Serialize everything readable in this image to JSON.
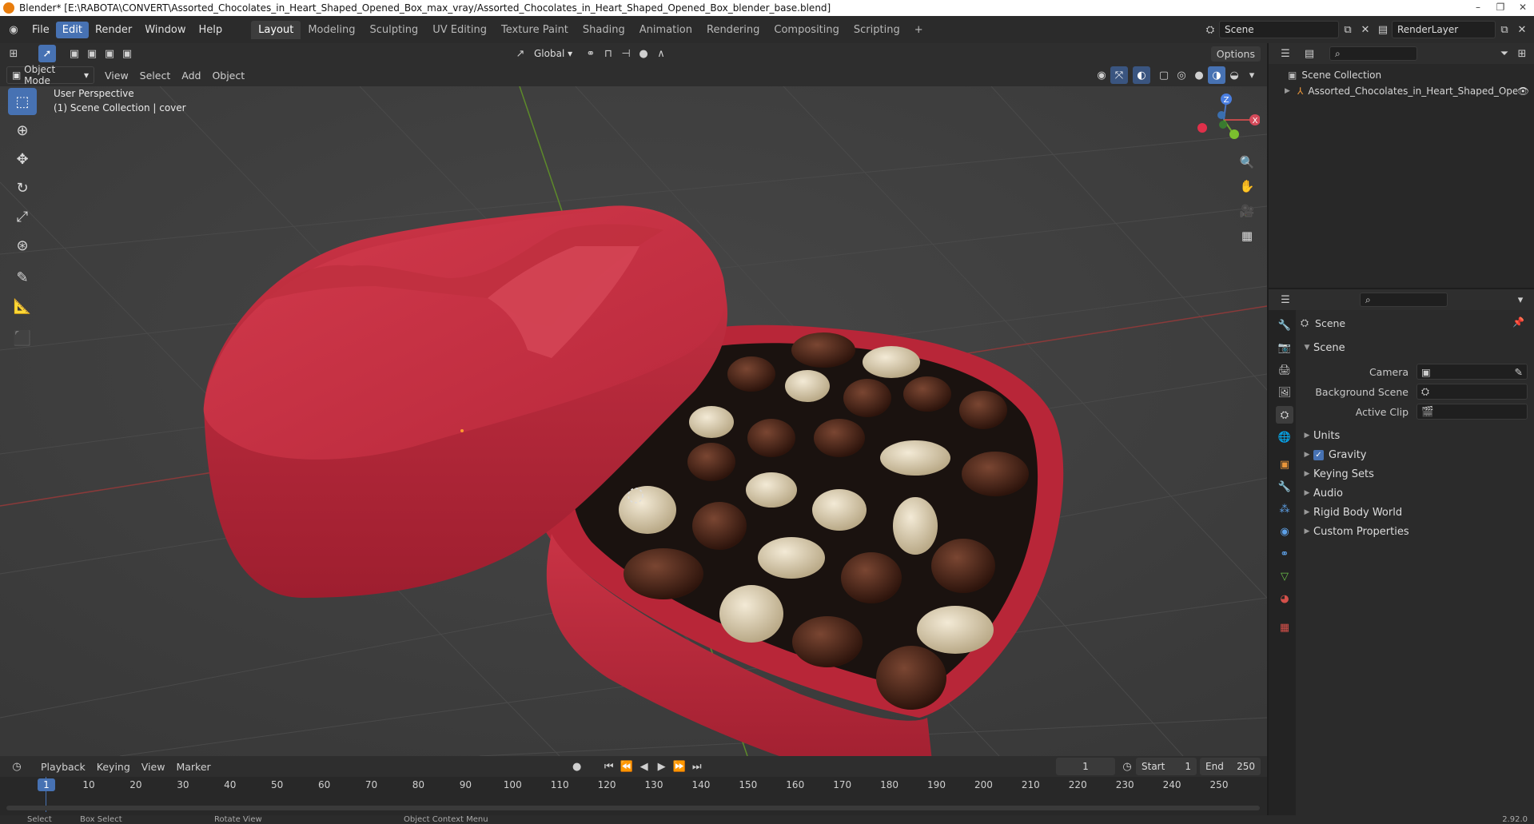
{
  "window": {
    "title": "Blender* [E:\\RABOTA\\CONVERT\\Assorted_Chocolates_in_Heart_Shaped_Opened_Box_max_vray/Assorted_Chocolates_in_Heart_Shaped_Opened_Box_blender_base.blend]",
    "controls": [
      "–",
      "❐",
      "✕"
    ]
  },
  "menu": {
    "items": [
      "File",
      "Edit",
      "Render",
      "Window",
      "Help"
    ],
    "active": "Edit"
  },
  "workspaces": {
    "tabs": [
      "Layout",
      "Modeling",
      "Sculpting",
      "UV Editing",
      "Texture Paint",
      "Shading",
      "Animation",
      "Rendering",
      "Compositing",
      "Scripting"
    ],
    "active": "Layout",
    "add": "+"
  },
  "scene_selector": {
    "value": "Scene"
  },
  "view_layer_selector": {
    "value": "RenderLayer"
  },
  "tool_header": {
    "transform_orientation": "Global",
    "options_label": "Options"
  },
  "viewport_header": {
    "mode": "Object Mode",
    "menus": [
      "View",
      "Select",
      "Add",
      "Object"
    ]
  },
  "viewport": {
    "perspective_label": "User Perspective",
    "collection_label": "(1) Scene Collection | cover",
    "background_color": "#3f3f3f",
    "gizmo": {
      "z": "Z",
      "x": "X"
    }
  },
  "tools": [
    "select-box",
    "cursor",
    "move",
    "rotate",
    "scale",
    "transform",
    "annotate",
    "measure",
    "add-cube"
  ],
  "outliner": {
    "root": "Scene Collection",
    "items": [
      "Assorted_Chocolates_in_Heart_Shaped_Oper"
    ]
  },
  "properties": {
    "context_title": "Scene",
    "section_title": "Scene",
    "fields": [
      {
        "label": "Camera",
        "value": ""
      },
      {
        "label": "Background Scene",
        "value": ""
      },
      {
        "label": "Active Clip",
        "value": ""
      }
    ],
    "panels": [
      {
        "label": "Units",
        "checkbox": false
      },
      {
        "label": "Gravity",
        "checkbox": true
      },
      {
        "label": "Keying Sets",
        "checkbox": false
      },
      {
        "label": "Audio",
        "checkbox": false
      },
      {
        "label": "Rigid Body World",
        "checkbox": false
      },
      {
        "label": "Custom Properties",
        "checkbox": false
      }
    ]
  },
  "timeline": {
    "menus": [
      "Playback",
      "Keying",
      "View",
      "Marker"
    ],
    "current_frame": "1",
    "start_label": "Start",
    "start": "1",
    "end_label": "End",
    "end": "250",
    "ticks": [
      "1",
      "10",
      "20",
      "30",
      "40",
      "50",
      "60",
      "70",
      "80",
      "90",
      "100",
      "110",
      "120",
      "130",
      "140",
      "150",
      "160",
      "170",
      "180",
      "190",
      "200",
      "210",
      "220",
      "230",
      "240",
      "250"
    ]
  },
  "status": {
    "items": [
      "Select",
      "Box Select",
      "Rotate View",
      "Object Context Menu"
    ],
    "version": "2.92.0"
  },
  "colors": {
    "accent": "#4772b3",
    "box_red": "#c22b3d",
    "chocolate": "#4a2418"
  }
}
